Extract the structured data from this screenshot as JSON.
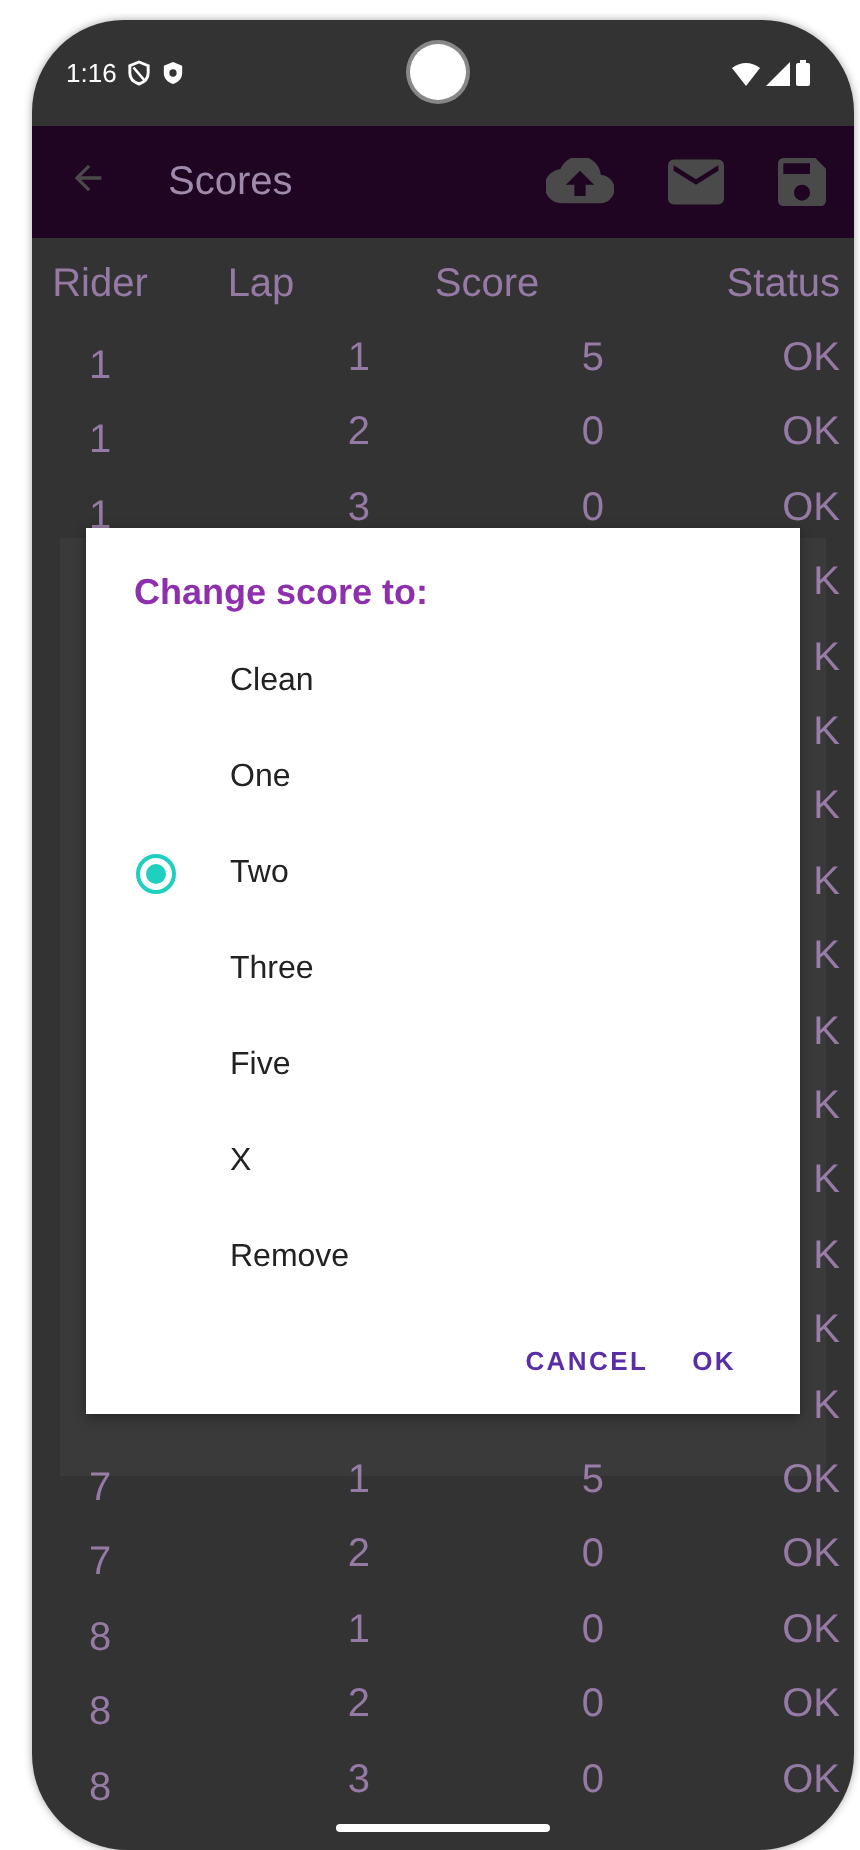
{
  "status_bar": {
    "time": "1:16"
  },
  "app_bar": {
    "title": "Scores"
  },
  "table": {
    "columns": [
      "Rider",
      "Lap",
      "Score",
      "Status"
    ],
    "rows": [
      {
        "rider": "1",
        "lap": "1",
        "score": "5",
        "status": "OK"
      },
      {
        "rider": "1",
        "lap": "2",
        "score": "0",
        "status": "OK"
      },
      {
        "rider": "1",
        "lap": "3",
        "score": "0",
        "status": "OK"
      },
      {
        "status": "K"
      },
      {
        "status": "K"
      },
      {
        "status": "K"
      },
      {
        "status": "K"
      },
      {
        "status": "K"
      },
      {
        "status": "K"
      },
      {
        "status": "K"
      },
      {
        "status": "K"
      },
      {
        "status": "K"
      },
      {
        "status": "K"
      },
      {
        "status": "K"
      },
      {
        "status": "K"
      },
      {
        "rider": "7",
        "lap": "1",
        "score": "5",
        "status": "OK"
      },
      {
        "rider": "7",
        "lap": "2",
        "score": "0",
        "status": "OK"
      },
      {
        "rider": "8",
        "lap": "1",
        "score": "0",
        "status": "OK"
      },
      {
        "rider": "8",
        "lap": "2",
        "score": "0",
        "status": "OK"
      },
      {
        "rider": "8",
        "lap": "3",
        "score": "0",
        "status": "OK"
      }
    ]
  },
  "dialog": {
    "title": "Change score to:",
    "options": [
      {
        "label": "Clean",
        "selected": false
      },
      {
        "label": "One",
        "selected": false
      },
      {
        "label": "Two",
        "selected": true
      },
      {
        "label": "Three",
        "selected": false
      },
      {
        "label": "Five",
        "selected": false
      },
      {
        "label": "X",
        "selected": false
      },
      {
        "label": "Remove",
        "selected": false
      }
    ],
    "buttons": [
      "CANCEL",
      "OK"
    ]
  }
}
